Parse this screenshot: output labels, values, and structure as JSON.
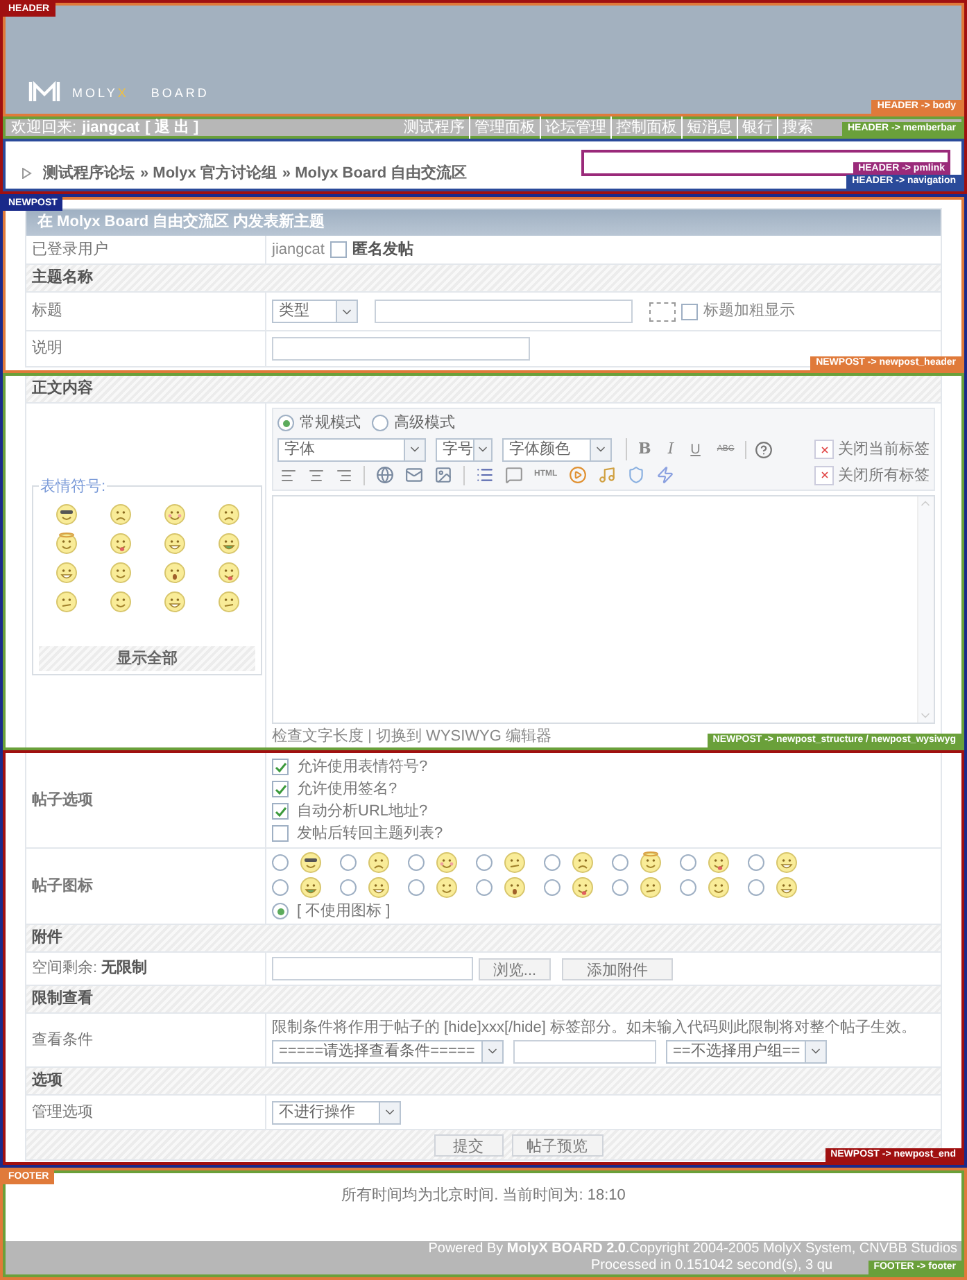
{
  "header": {
    "tag": "HEADER",
    "body": {
      "tag": "HEADER -> body",
      "logo": [
        "MOLY",
        "X",
        "BOARD"
      ]
    },
    "memberbar": {
      "tag": "HEADER -> memberbar",
      "welcome": "欢迎回来:",
      "user": "jiangcat",
      "logout": "[ 退 出 ]",
      "links": [
        "测试程序",
        "管理面板",
        "论坛管理",
        "控制面板",
        "短消息",
        "银行",
        "搜索"
      ]
    },
    "navigation": {
      "tag": "HEADER -> navigation",
      "pmlink_tag": "HEADER -> pmlink",
      "crumbs": [
        "测试程序论坛",
        "» Molyx 官方讨论组",
        "» Molyx Board 自由交流区"
      ]
    }
  },
  "newpost": {
    "tag": "NEWPOST",
    "title": "在 Molyx Board 自由交流区 内发表新主题",
    "header": {
      "tag": "NEWPOST -> newpost_header",
      "user_label": "已登录用户",
      "user": "jiangcat",
      "anonymous": {
        "label": "匿名发帖",
        "checked": false
      },
      "subject_section": "主题名称",
      "title_label": "标题",
      "type_select": "类型",
      "bold_title": {
        "label": "标题加粗显示",
        "checked": false
      },
      "desc_label": "说明"
    },
    "structure": {
      "tag": "NEWPOST -> newpost_structure / newpost_wysiwyg",
      "section": "正文内容",
      "smilies_legend": "表情符号:",
      "smilies": [
        {
          "kind": "cool"
        },
        {
          "kind": "sad"
        },
        {
          "kind": "blush"
        },
        {
          "kind": "frown"
        },
        {
          "kind": "angel"
        },
        {
          "kind": "tongue"
        },
        {
          "kind": "grin"
        },
        {
          "kind": "money"
        },
        {
          "kind": "teeth"
        },
        {
          "kind": "smile"
        },
        {
          "kind": "shock"
        },
        {
          "kind": "silly"
        },
        {
          "kind": "confused"
        },
        {
          "kind": "wink"
        },
        {
          "kind": "laugh"
        },
        {
          "kind": "sick"
        }
      ],
      "show_all": "显示全部",
      "modes": [
        {
          "label": "常规模式",
          "selected": true
        },
        {
          "label": "高级模式",
          "selected": false
        }
      ],
      "selects": [
        "字体",
        "字号",
        "字体颜色"
      ],
      "format_buttons": [
        "B",
        "I",
        "U",
        "ABC"
      ],
      "close_current": "关闭当前标签",
      "close_all": "关闭所有标签",
      "html_button": "HTML",
      "check_length": "检查文字长度",
      "switch_editor": "切换到 WYSIWYG 编辑器"
    },
    "end": {
      "tag": "NEWPOST -> newpost_end",
      "options_label": "帖子选项",
      "options": [
        {
          "label": "允许使用表情符号?",
          "checked": true
        },
        {
          "label": "允许使用签名?",
          "checked": true
        },
        {
          "label": "自动分析URL地址?",
          "checked": true
        },
        {
          "label": "发帖后转回主题列表?",
          "checked": false
        }
      ],
      "icon_label": "帖子图标",
      "icons": [
        {
          "kind": "cool",
          "selected": false
        },
        {
          "kind": "sad",
          "selected": false
        },
        {
          "kind": "blush",
          "selected": false
        },
        {
          "kind": "sick",
          "selected": false
        },
        {
          "kind": "frown",
          "selected": false
        },
        {
          "kind": "angel",
          "selected": false
        },
        {
          "kind": "tongue",
          "selected": false
        },
        {
          "kind": "grin",
          "selected": false
        },
        {
          "kind": "money",
          "selected": false
        },
        {
          "kind": "teeth",
          "selected": false
        },
        {
          "kind": "smile",
          "selected": false
        },
        {
          "kind": "shock",
          "selected": false
        },
        {
          "kind": "silly",
          "selected": false
        },
        {
          "kind": "confused",
          "selected": false
        },
        {
          "kind": "wink",
          "selected": false
        },
        {
          "kind": "laugh",
          "selected": false
        }
      ],
      "no_icon": {
        "label": "[ 不使用图标 ]",
        "selected": true
      },
      "attach_section": "附件",
      "space_label": "空间剩余:",
      "space_value": "无限制",
      "browse": "浏览...",
      "add": "添加附件",
      "restrict_section": "限制查看",
      "cond_label": "查看条件",
      "hint": "限制条件将作用于帖子的 [hide]xxx[/hide] 标签部分。如未输入代码则此限制将对整个帖子生效。",
      "cond_select": "=====请选择查看条件=====",
      "group_select": "==不选择用户组==",
      "options_section": "选项",
      "admin_label": "管理选项",
      "admin_select": "不进行操作",
      "submit": "提交",
      "preview": "帖子预览"
    }
  },
  "footer": {
    "tag": "FOOTER",
    "time": "所有时间均为北京时间. 当前时间为: 18:10",
    "powered": "Powered By",
    "brand": "MolyX BOARD 2.0",
    "copyright": ".Copyright 2004-2005 MolyX System, CNVBB Studios",
    "processed": "Processed in 0.151042 second(s), 3 qu",
    "footer_tag": "FOOTER -> footer"
  }
}
